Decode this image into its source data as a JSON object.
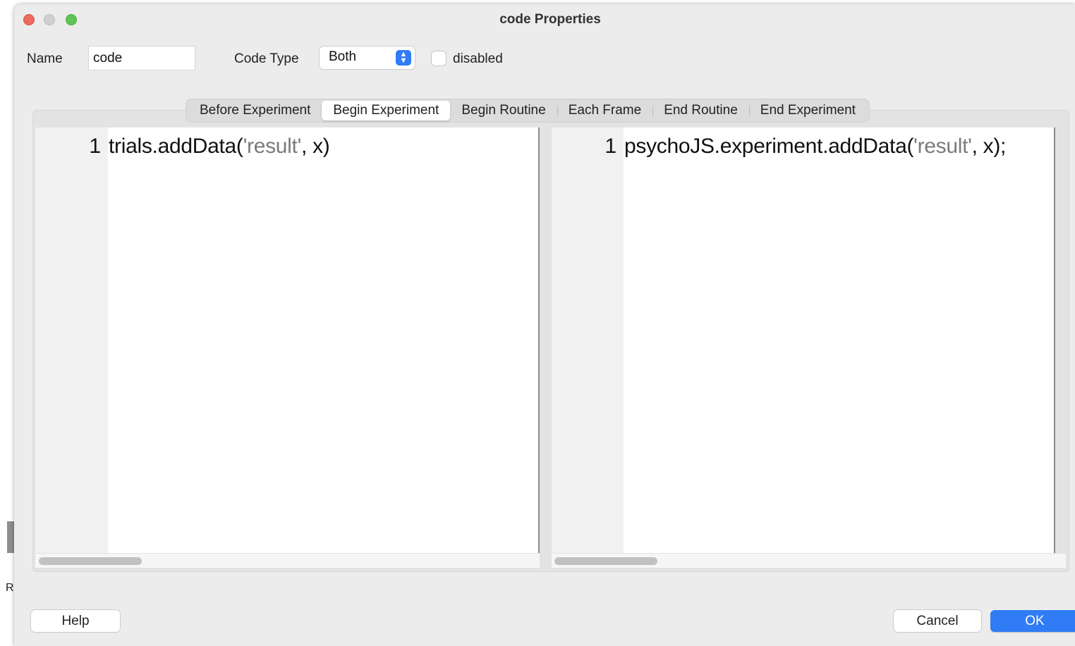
{
  "window": {
    "title": "code Properties",
    "background_letter": "R"
  },
  "form": {
    "name_label": "Name",
    "name_value": "code",
    "code_type_label": "Code Type",
    "code_type_value": "Both",
    "disabled_label": "disabled",
    "disabled_checked": false
  },
  "tabs": [
    {
      "label": "Before Experiment",
      "active": false
    },
    {
      "label": "Begin Experiment",
      "active": true
    },
    {
      "label": "Begin Routine",
      "active": false
    },
    {
      "label": "Each Frame",
      "active": false
    },
    {
      "label": "End Routine",
      "active": false
    },
    {
      "label": "End Experiment",
      "active": false
    }
  ],
  "editors": {
    "python": {
      "line_number": "1",
      "code_pre": "trials.addData(",
      "code_str": "'result'",
      "code_post": ", x)"
    },
    "javascript": {
      "line_number": "1",
      "code_pre": "psychoJS.experiment.addData(",
      "code_str": "'result'",
      "code_post": ", x);"
    }
  },
  "buttons": {
    "help": "Help",
    "cancel": "Cancel",
    "ok": "OK"
  },
  "colors": {
    "accent": "#2f7cf6",
    "string_literal": "#7b7b7b",
    "close": "#ed6a5e",
    "maximize": "#5fc453"
  }
}
